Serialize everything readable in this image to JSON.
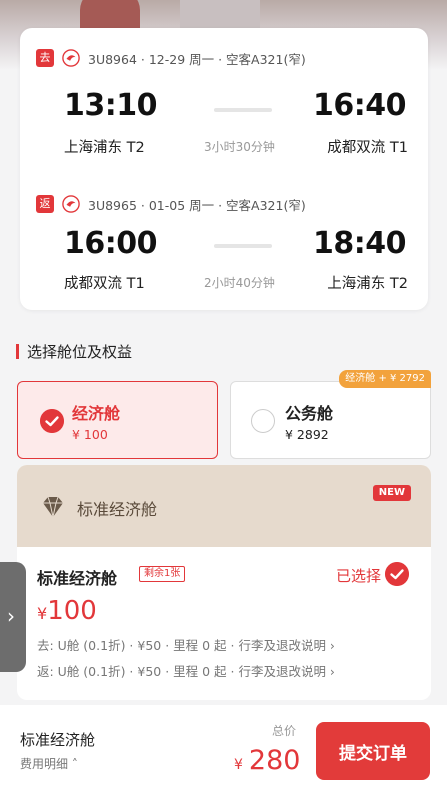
{
  "hero": {
    "text": ""
  },
  "flights": [
    {
      "tag": "去",
      "info": "3U8964 · 12-29 周一 · 空客A321(窄)",
      "dep_time": "13:10",
      "arr_time": "16:40",
      "dep_airport": "上海浦东 T2",
      "arr_airport": "成都双流 T1",
      "duration": "3小时30分钟"
    },
    {
      "tag": "返",
      "info": "3U8965 · 01-05 周一 · 空客A321(窄)",
      "dep_time": "16:00",
      "arr_time": "18:40",
      "dep_airport": "成都双流 T1",
      "arr_airport": "上海浦东 T2",
      "duration": "2小时40分钟"
    }
  ],
  "section": {
    "title": "选择舱位及权益"
  },
  "cabins": {
    "economy": {
      "name": "经济舱",
      "price": "¥ 100",
      "selected": true
    },
    "business": {
      "name": "公务舱",
      "price": "¥ 2892",
      "badge": "经济舱 + ¥ 2792",
      "selected": false
    }
  },
  "fare": {
    "header_title": "标准经济舱",
    "new_badge": "NEW",
    "title": "标准经济舱",
    "remaining": "剩余1张",
    "selected_label": "已选择",
    "price_currency": "¥",
    "price": "100",
    "rule_outbound": "去: U舱 (0.1折) · ¥50 · 里程 0 起 · 行李及退改说明 ›",
    "rule_return": "返: U舱 (0.1折) · ¥50 · 里程 0 起 · 行李及退改说明 ›"
  },
  "side_tab": {
    "icon": "›"
  },
  "bottom": {
    "title": "标准经济舱",
    "details": "费用明细 ˄",
    "total_label": "总价",
    "total_currency": "¥",
    "total": "280",
    "submit": "提交订单"
  },
  "colors": {
    "accent": "#e2373a",
    "premium": "#e6dacd",
    "badge": "#f2a23c"
  }
}
